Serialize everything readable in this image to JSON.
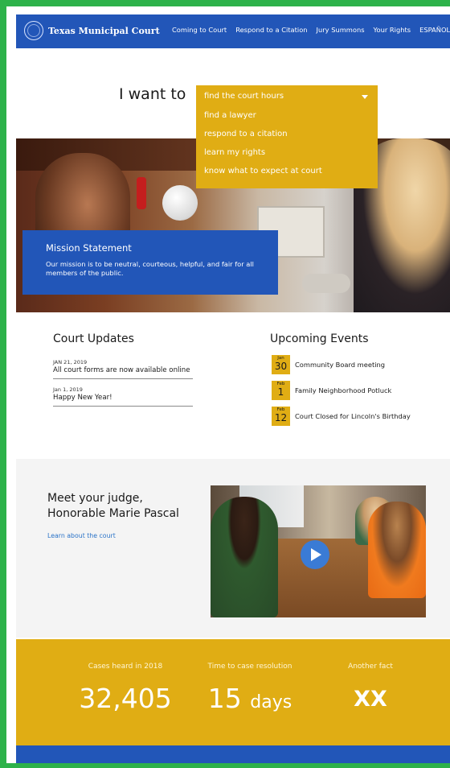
{
  "nav": {
    "brand": "Texas Municipal Court",
    "links": [
      "Coming to Court",
      "Respond to a Citation",
      "Jury Summons",
      "Your Rights",
      "ESPAÑOL"
    ]
  },
  "hero": {
    "prompt": "I want to",
    "dropdown": {
      "selected": "find the court hours",
      "options": [
        "find a lawyer",
        "respond to a citation",
        "learn my rights",
        "know what to expect at court"
      ]
    },
    "mission": {
      "title": "Mission Statement",
      "text": "Our mission is to be neutral, courteous, helpful, and fair for all members of the public."
    }
  },
  "updates": {
    "title": "Court Updates",
    "items": [
      {
        "date": "JAN 21, 2019",
        "text": "All court forms are now available online"
      },
      {
        "date": "Jan 1, 2019",
        "text": "Happy New Year!"
      }
    ]
  },
  "events": {
    "title": "Upcoming Events",
    "items": [
      {
        "month": "Jan",
        "day": "30",
        "title": "Community Board meeting"
      },
      {
        "month": "Feb",
        "day": "1",
        "title": "Family Neighborhood Potluck"
      },
      {
        "month": "Feb",
        "day": "12",
        "title": "Court Closed for Lincoln's Birthday"
      }
    ]
  },
  "judge": {
    "title_line1": "Meet your judge,",
    "title_line2": "Honorable Marie Pascal",
    "link": "Learn about the court"
  },
  "stats": [
    {
      "label": "Cases heard in 2018",
      "value": "32,405",
      "unit": ""
    },
    {
      "label": "Time to case resolution",
      "value": "15",
      "unit": "days"
    },
    {
      "label": "Another fact",
      "value": "XX",
      "unit": ""
    }
  ],
  "colors": {
    "primary_blue": "#2256b8",
    "accent_gold": "#e0ad14",
    "frame_green": "#2db24a",
    "link_blue": "#2a73c8"
  }
}
